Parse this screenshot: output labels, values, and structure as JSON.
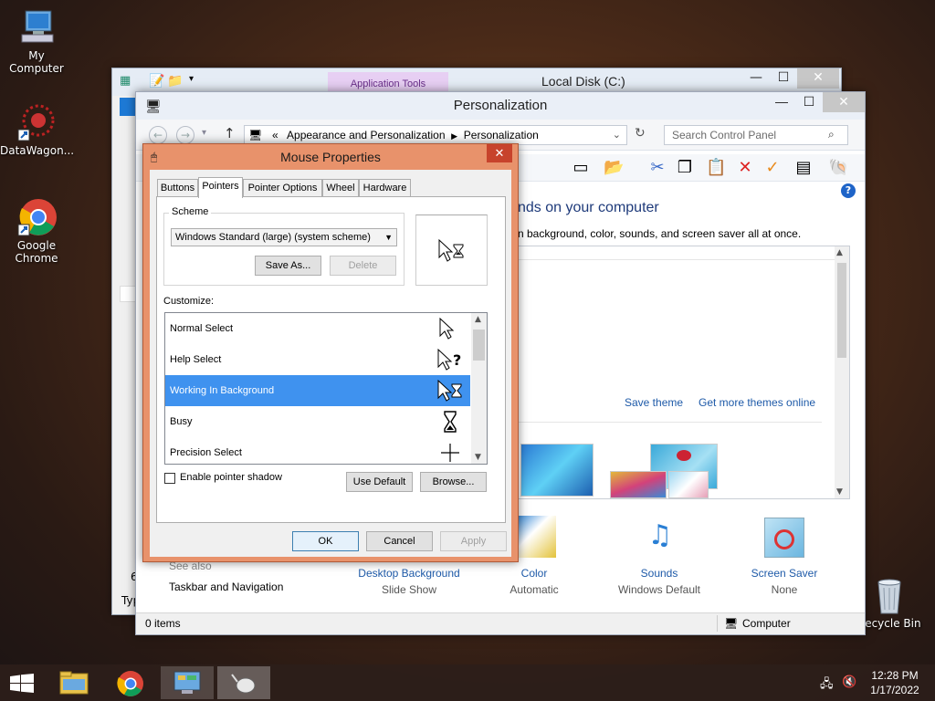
{
  "desktop": {
    "icons": [
      {
        "label": "My Computer"
      },
      {
        "label": "DataWagon..."
      },
      {
        "label": "Google Chrome"
      },
      {
        "label": "Recycle Bin"
      }
    ]
  },
  "explorer": {
    "title": "Local Disk (C:)",
    "ribbon_context": "Application Tools",
    "left_partial": "6",
    "left_partial2": "Typ"
  },
  "personalization": {
    "title": "Personalization",
    "breadcrumb": {
      "prefix": "«",
      "items": [
        "Appearance and Personalization",
        "Personalization"
      ]
    },
    "search_placeholder": "Search Control Panel",
    "heading": "nds on your computer",
    "subheading": "n background, color, sounds, and screen saver all at once.",
    "save_theme": "Save theme",
    "get_more_themes": "Get more themes online",
    "see_also": "See also",
    "taskbar_nav": "Taskbar and Navigation",
    "bottom_items": [
      {
        "title": "Desktop Background",
        "sub": "Slide Show"
      },
      {
        "title": "Color",
        "sub": "Automatic"
      },
      {
        "title": "Sounds",
        "sub": "Windows Default"
      },
      {
        "title": "Screen Saver",
        "sub": "None"
      }
    ],
    "status_items": "0 items",
    "status_location": "Computer"
  },
  "mouse_properties": {
    "title": "Mouse Properties",
    "tabs": [
      "Buttons",
      "Pointers",
      "Pointer Options",
      "Wheel",
      "Hardware"
    ],
    "active_tab": "Pointers",
    "scheme_label": "Scheme",
    "scheme_value": "Windows Standard (large) (system scheme)",
    "save_as": "Save As...",
    "delete": "Delete",
    "customize_label": "Customize:",
    "cursors": [
      {
        "name": "Normal Select",
        "selected": false
      },
      {
        "name": "Help Select",
        "selected": false
      },
      {
        "name": "Working In Background",
        "selected": true
      },
      {
        "name": "Busy",
        "selected": false
      },
      {
        "name": "Precision Select",
        "selected": false
      }
    ],
    "enable_shadow": "Enable pointer shadow",
    "enable_shadow_checked": false,
    "use_default": "Use Default",
    "browse": "Browse...",
    "ok": "OK",
    "cancel": "Cancel",
    "apply": "Apply"
  },
  "taskbar": {
    "time": "12:28 PM",
    "date": "1/17/2022"
  },
  "colors": {
    "dialog_frame": "#e8926b",
    "selection": "#3f92ef",
    "link": "#1e5aa8"
  }
}
